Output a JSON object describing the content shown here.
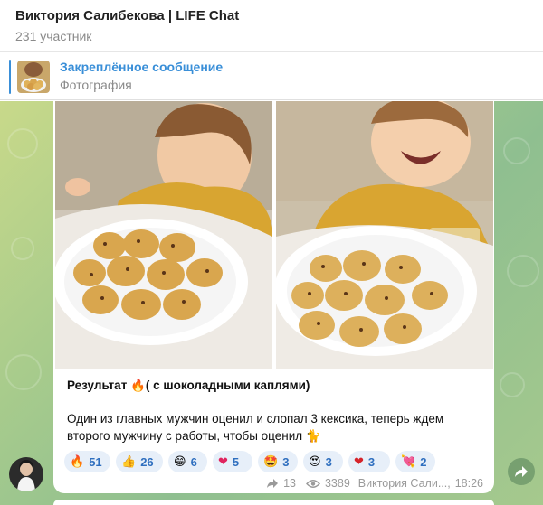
{
  "header": {
    "title": "Виктория Салибекова | LIFE Chat",
    "subtitle": "231 участник"
  },
  "pinned": {
    "title": "Закреплённое сообщение",
    "subtitle": "Фотография"
  },
  "message": {
    "caption_head": "Результат 🔥( с шоколадными каплями)",
    "caption_body": "Один из главных мужчин оценил и слопал 3 кексика, теперь ждем второго мужчину с работы, чтобы оценил 🐈",
    "reactions": [
      {
        "emoji": "🔥",
        "count": "51"
      },
      {
        "emoji": "👍",
        "count": "26"
      },
      {
        "emoji": "😁",
        "count": "6"
      },
      {
        "emoji": "❤",
        "count": "5"
      },
      {
        "emoji": "🤩",
        "count": "3"
      },
      {
        "emoji": "😍",
        "count": "3"
      },
      {
        "emoji": "❤",
        "count": "3"
      },
      {
        "emoji": "💘",
        "count": "2"
      }
    ],
    "forwards": "13",
    "views": "3389",
    "author": "Виктория Сали...,",
    "time": "18:26"
  },
  "icons": {
    "forward": "forward-icon",
    "views": "eye-icon",
    "share": "share-arrow-icon"
  },
  "colors": {
    "accent": "#3a8fd8",
    "reaction_bg": "#e7eff9",
    "reaction_text": "#2f6fbf"
  }
}
